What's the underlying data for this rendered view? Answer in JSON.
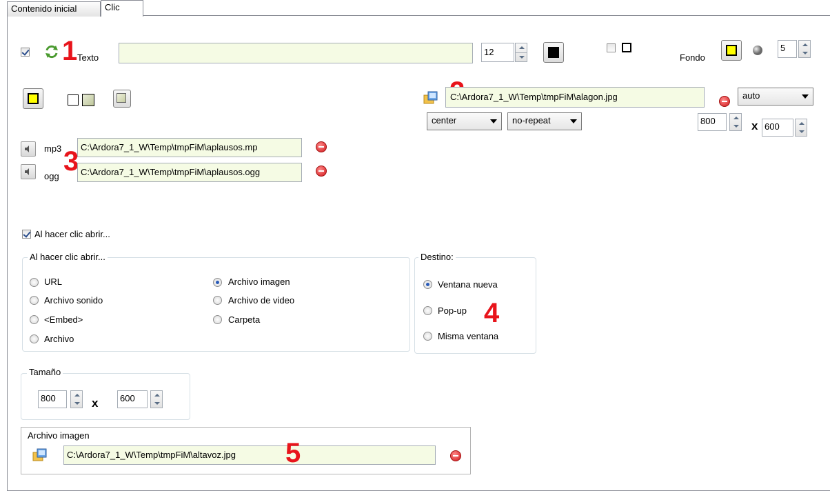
{
  "tabs": {
    "tab1": "Contenido inicial",
    "tab2": "Clic"
  },
  "text_row": {
    "label": "Texto",
    "value": "",
    "font_size": "12",
    "fondo_label": "Fondo",
    "border_size": "5"
  },
  "background_image": {
    "path": "C:\\Ardora7_1_W\\Temp\\tmpFiM\\alagon.jpg",
    "size_mode": "auto",
    "position": "center",
    "repeat": "no-repeat",
    "width": "800",
    "height": "600",
    "x": "x"
  },
  "sounds": {
    "mp3_label": "mp3",
    "mp3_path": "C:\\Ardora7_1_W\\Temp\\tmpFiM\\aplausos.mp",
    "ogg_label": "ogg",
    "ogg_path": "C:\\Ardora7_1_W\\Temp\\tmpFiM\\aplausos.ogg"
  },
  "click_open": {
    "checkbox_label": "Al hacer clic abrir...",
    "group_title": "Al hacer clic abrir...",
    "options": {
      "url": "URL",
      "sound": "Archivo sonido",
      "embed": "<Embed>",
      "file": "Archivo",
      "image": "Archivo imagen",
      "video": "Archivo de video",
      "folder": "Carpeta"
    },
    "selected": "Archivo imagen"
  },
  "destino": {
    "title": "Destino:",
    "options": {
      "new": "Ventana nueva",
      "popup": "Pop-up",
      "same": "Misma ventana"
    },
    "selected": "Ventana nueva"
  },
  "tamano": {
    "title": "Tamaño",
    "width": "800",
    "height": "600",
    "x": "x"
  },
  "archivo_imagen": {
    "title": "Archivo imagen",
    "path": "C:\\Ardora7_1_W\\Temp\\tmpFiM\\altavoz.jpg"
  },
  "annotations": {
    "n1": "1",
    "n2": "2",
    "n3": "3",
    "n4": "4",
    "n5": "5"
  },
  "colors": {
    "accent_red": "#e8141b",
    "field_bg": "#f5fbe4",
    "yellow": "#ffff00"
  }
}
